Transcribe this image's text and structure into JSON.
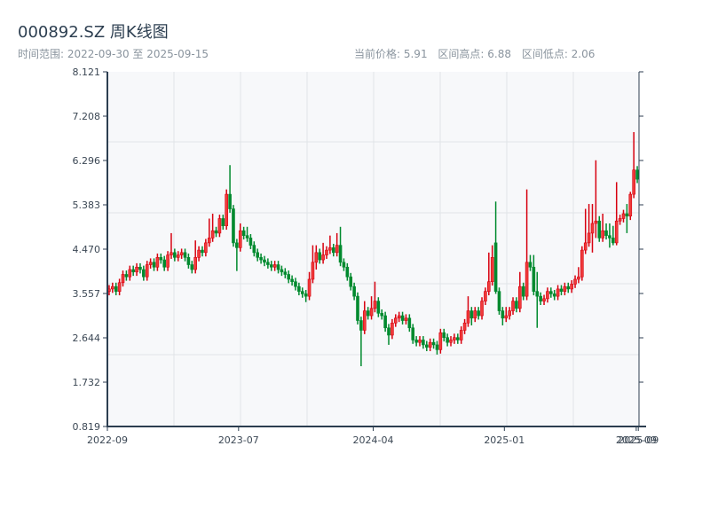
{
  "header": {
    "title": "000892.SZ 周K线图",
    "range_label": "时间范围: 2022-09-30 至 2025-09-15",
    "current_price": "当前价格: 5.91",
    "range_high": "区间高点: 6.88",
    "range_low": "区间低点: 2.06"
  },
  "chart_data": {
    "type": "candlestick",
    "title": "000892.SZ 周K线图",
    "ylim": [
      0.819,
      8.121
    ],
    "y_ticks": [
      "0.819",
      "1.732",
      "2.644",
      "3.557",
      "4.470",
      "5.383",
      "6.296",
      "7.208",
      "8.121"
    ],
    "x_ticks": [
      {
        "label": "2022-09",
        "index": 0
      },
      {
        "label": "2023-07",
        "index": 38
      },
      {
        "label": "2024-04",
        "index": 77
      },
      {
        "label": "2025-01",
        "index": 115
      },
      {
        "label": "2025-09",
        "index": 153.2
      },
      {
        "label": "2025-09",
        "index": 153.8
      }
    ],
    "grid": true,
    "colors": {
      "up": "#d7000f",
      "down": "#008a2e",
      "background": "#f7f8fa",
      "axis": "#2c3e50",
      "grid": "#e1e4e8"
    },
    "ohlc": [
      [
        3.6,
        3.73,
        3.52,
        3.65
      ],
      [
        3.65,
        3.78,
        3.57,
        3.7
      ],
      [
        3.7,
        3.78,
        3.52,
        3.6
      ],
      [
        3.6,
        3.86,
        3.52,
        3.78
      ],
      [
        3.78,
        4.03,
        3.7,
        3.95
      ],
      [
        3.95,
        4.03,
        3.82,
        3.9
      ],
      [
        3.9,
        4.13,
        3.82,
        4.05
      ],
      [
        4.05,
        4.13,
        3.92,
        4.0
      ],
      [
        4.0,
        4.18,
        3.92,
        4.1
      ],
      [
        4.1,
        4.18,
        3.97,
        4.05
      ],
      [
        4.05,
        4.13,
        3.82,
        3.9
      ],
      [
        3.9,
        4.23,
        3.82,
        4.15
      ],
      [
        4.15,
        4.28,
        4.07,
        4.2
      ],
      [
        4.2,
        4.28,
        4.02,
        4.1
      ],
      [
        4.1,
        4.38,
        4.02,
        4.3
      ],
      [
        4.3,
        4.38,
        4.17,
        4.25
      ],
      [
        4.25,
        4.33,
        4.02,
        4.1
      ],
      [
        4.1,
        4.43,
        4.02,
        4.35
      ],
      [
        4.35,
        4.8,
        4.27,
        4.4
      ],
      [
        4.4,
        4.48,
        4.22,
        4.3
      ],
      [
        4.3,
        4.43,
        4.22,
        4.35
      ],
      [
        4.35,
        4.48,
        4.27,
        4.4
      ],
      [
        4.4,
        4.48,
        4.22,
        4.3
      ],
      [
        4.3,
        4.38,
        4.07,
        4.15
      ],
      [
        4.15,
        4.23,
        3.97,
        4.05
      ],
      [
        4.05,
        4.65,
        3.97,
        4.3
      ],
      [
        4.3,
        4.53,
        4.22,
        4.45
      ],
      [
        4.45,
        4.53,
        4.32,
        4.4
      ],
      [
        4.4,
        4.68,
        4.32,
        4.6
      ],
      [
        4.6,
        5.1,
        4.52,
        4.7
      ],
      [
        4.7,
        5.2,
        4.62,
        4.85
      ],
      [
        4.85,
        4.93,
        4.72,
        4.8
      ],
      [
        4.8,
        5.18,
        4.72,
        5.1
      ],
      [
        5.1,
        5.18,
        4.87,
        4.95
      ],
      [
        4.95,
        5.7,
        4.87,
        5.6
      ],
      [
        5.6,
        6.2,
        5.22,
        5.3
      ],
      [
        5.3,
        5.38,
        4.52,
        4.6
      ],
      [
        4.6,
        4.68,
        4.02,
        4.5
      ],
      [
        4.5,
        5.0,
        4.42,
        4.85
      ],
      [
        4.85,
        4.93,
        4.67,
        4.75
      ],
      [
        4.75,
        4.93,
        4.62,
        4.7
      ],
      [
        4.7,
        4.78,
        4.47,
        4.55
      ],
      [
        4.55,
        4.63,
        4.32,
        4.4
      ],
      [
        4.4,
        4.48,
        4.22,
        4.3
      ],
      [
        4.3,
        4.38,
        4.17,
        4.25
      ],
      [
        4.25,
        4.33,
        4.12,
        4.2
      ],
      [
        4.2,
        4.28,
        4.07,
        4.15
      ],
      [
        4.15,
        4.23,
        4.02,
        4.1
      ],
      [
        4.1,
        4.23,
        4.02,
        4.15
      ],
      [
        4.15,
        4.23,
        3.97,
        4.05
      ],
      [
        4.05,
        4.13,
        3.92,
        4.0
      ],
      [
        4.0,
        4.08,
        3.87,
        3.95
      ],
      [
        3.95,
        4.03,
        3.77,
        3.85
      ],
      [
        3.85,
        3.93,
        3.72,
        3.8
      ],
      [
        3.8,
        3.88,
        3.62,
        3.7
      ],
      [
        3.7,
        3.78,
        3.52,
        3.6
      ],
      [
        3.6,
        3.68,
        3.47,
        3.55
      ],
      [
        3.55,
        3.63,
        3.38,
        3.5
      ],
      [
        3.5,
        4.0,
        3.42,
        3.85
      ],
      [
        3.85,
        4.55,
        3.77,
        4.2
      ],
      [
        4.2,
        4.55,
        4.05,
        4.4
      ],
      [
        4.4,
        4.48,
        4.17,
        4.25
      ],
      [
        4.25,
        4.6,
        4.17,
        4.35
      ],
      [
        4.35,
        4.53,
        4.27,
        4.45
      ],
      [
        4.45,
        4.75,
        4.37,
        4.5
      ],
      [
        4.5,
        4.58,
        4.32,
        4.4
      ],
      [
        4.4,
        4.8,
        4.32,
        4.55
      ],
      [
        4.55,
        4.93,
        4.12,
        4.2
      ],
      [
        4.2,
        4.28,
        4.02,
        4.1
      ],
      [
        4.1,
        4.18,
        3.82,
        3.9
      ],
      [
        3.9,
        3.98,
        3.62,
        3.7
      ],
      [
        3.7,
        3.78,
        3.42,
        3.5
      ],
      [
        3.5,
        3.58,
        2.92,
        3.0
      ],
      [
        3.0,
        3.08,
        2.06,
        2.8
      ],
      [
        2.8,
        3.4,
        2.72,
        3.2
      ],
      [
        3.2,
        3.28,
        3.02,
        3.1
      ],
      [
        3.1,
        3.5,
        3.02,
        3.25
      ],
      [
        3.25,
        3.8,
        3.17,
        3.4
      ],
      [
        3.4,
        3.48,
        3.07,
        3.15
      ],
      [
        3.15,
        3.23,
        3.02,
        3.1
      ],
      [
        3.1,
        3.18,
        2.77,
        2.85
      ],
      [
        2.85,
        2.93,
        2.5,
        2.7
      ],
      [
        2.7,
        3.03,
        2.62,
        2.95
      ],
      [
        2.95,
        3.13,
        2.87,
        3.05
      ],
      [
        3.05,
        3.18,
        2.97,
        3.1
      ],
      [
        3.1,
        3.18,
        2.92,
        3.0
      ],
      [
        3.0,
        3.13,
        2.92,
        3.05
      ],
      [
        3.05,
        3.13,
        2.77,
        2.85
      ],
      [
        2.85,
        2.93,
        2.52,
        2.6
      ],
      [
        2.6,
        2.68,
        2.47,
        2.55
      ],
      [
        2.55,
        2.68,
        2.47,
        2.6
      ],
      [
        2.6,
        2.68,
        2.42,
        2.5
      ],
      [
        2.5,
        2.58,
        2.37,
        2.45
      ],
      [
        2.45,
        2.63,
        2.37,
        2.55
      ],
      [
        2.55,
        2.63,
        2.42,
        2.5
      ],
      [
        2.5,
        2.58,
        2.3,
        2.4
      ],
      [
        2.4,
        2.83,
        2.32,
        2.75
      ],
      [
        2.75,
        2.83,
        2.57,
        2.65
      ],
      [
        2.65,
        2.73,
        2.47,
        2.55
      ],
      [
        2.55,
        2.68,
        2.47,
        2.6
      ],
      [
        2.6,
        2.73,
        2.52,
        2.65
      ],
      [
        2.65,
        2.73,
        2.52,
        2.6
      ],
      [
        2.6,
        2.88,
        2.52,
        2.8
      ],
      [
        2.8,
        3.03,
        2.72,
        2.95
      ],
      [
        2.95,
        3.5,
        2.87,
        3.2
      ],
      [
        3.2,
        3.28,
        2.9,
        3.05
      ],
      [
        3.05,
        3.28,
        2.97,
        3.2
      ],
      [
        3.2,
        3.28,
        3.02,
        3.1
      ],
      [
        3.1,
        3.48,
        3.02,
        3.4
      ],
      [
        3.4,
        3.68,
        3.32,
        3.6
      ],
      [
        3.6,
        4.4,
        3.52,
        3.8
      ],
      [
        3.8,
        4.55,
        3.72,
        4.3
      ],
      [
        4.6,
        5.45,
        3.55,
        3.6
      ],
      [
        3.6,
        3.68,
        3.12,
        3.2
      ],
      [
        3.2,
        3.28,
        2.9,
        3.05
      ],
      [
        3.05,
        3.28,
        2.97,
        3.1
      ],
      [
        3.1,
        3.28,
        3.02,
        3.2
      ],
      [
        3.2,
        3.48,
        3.12,
        3.4
      ],
      [
        3.4,
        3.48,
        3.17,
        3.25
      ],
      [
        3.25,
        4.0,
        3.17,
        3.7
      ],
      [
        3.7,
        3.78,
        3.42,
        3.5
      ],
      [
        3.5,
        5.7,
        3.42,
        4.2
      ],
      [
        4.2,
        4.35,
        4.02,
        4.1
      ],
      [
        4.1,
        4.35,
        3.52,
        3.6
      ],
      [
        3.6,
        4.0,
        2.85,
        3.5
      ],
      [
        3.5,
        3.58,
        3.32,
        3.4
      ],
      [
        3.4,
        3.53,
        3.32,
        3.45
      ],
      [
        3.45,
        3.68,
        3.37,
        3.6
      ],
      [
        3.6,
        3.68,
        3.47,
        3.55
      ],
      [
        3.55,
        3.63,
        3.42,
        3.5
      ],
      [
        3.5,
        3.73,
        3.42,
        3.65
      ],
      [
        3.65,
        3.73,
        3.52,
        3.6
      ],
      [
        3.6,
        3.78,
        3.52,
        3.7
      ],
      [
        3.7,
        3.78,
        3.57,
        3.65
      ],
      [
        3.65,
        3.83,
        3.57,
        3.75
      ],
      [
        3.75,
        3.93,
        3.67,
        3.85
      ],
      [
        3.85,
        4.1,
        3.77,
        3.9
      ],
      [
        3.9,
        4.53,
        3.82,
        4.45
      ],
      [
        4.45,
        5.3,
        4.37,
        4.6
      ],
      [
        4.6,
        5.4,
        4.52,
        4.8
      ],
      [
        4.8,
        5.4,
        4.4,
        5.0
      ],
      [
        5.0,
        6.3,
        4.7,
        5.05
      ],
      [
        5.05,
        5.15,
        4.62,
        4.7
      ],
      [
        4.7,
        5.2,
        4.62,
        4.85
      ],
      [
        4.85,
        5.0,
        4.67,
        4.75
      ],
      [
        4.75,
        5.0,
        4.5,
        4.7
      ],
      [
        4.7,
        4.95,
        4.55,
        4.6
      ],
      [
        4.6,
        5.85,
        4.55,
        5.05
      ],
      [
        5.05,
        5.18,
        4.97,
        5.1
      ],
      [
        5.1,
        5.28,
        5.02,
        5.2
      ],
      [
        5.2,
        5.4,
        4.8,
        5.15
      ],
      [
        5.15,
        5.65,
        5.07,
        5.6
      ],
      [
        5.6,
        6.88,
        5.52,
        6.1
      ],
      [
        6.1,
        6.18,
        5.83,
        5.91
      ]
    ]
  }
}
